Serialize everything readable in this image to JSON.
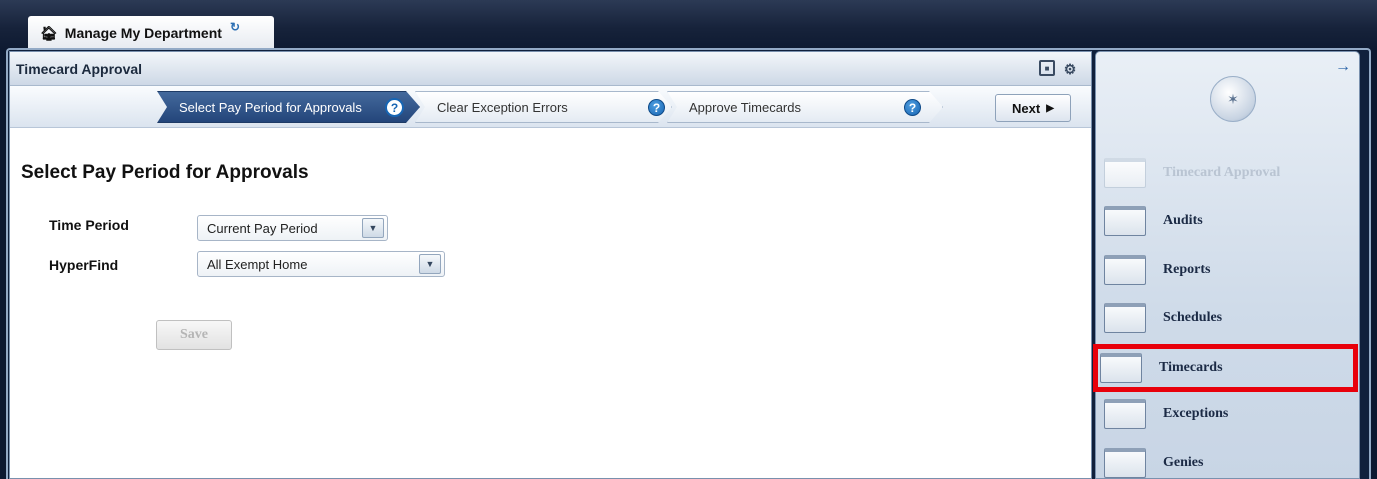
{
  "top_tab": {
    "label": "Manage My Department"
  },
  "panel": {
    "title": "Timecard Approval",
    "steps": [
      {
        "label": "Select Pay Period for Approvals",
        "state": "active"
      },
      {
        "label": "Clear Exception Errors",
        "state": "inactive"
      },
      {
        "label": "Approve Timecards",
        "state": "inactive"
      }
    ],
    "next_label": "Next",
    "page_title": "Select Pay Period for Approvals",
    "form": {
      "time_period_label": "Time Period",
      "time_period_value": "Current Pay Period",
      "hyperfind_label": "HyperFind",
      "hyperfind_value": "All Exempt Home",
      "save_label": "Save"
    }
  },
  "sidebar": {
    "items": [
      {
        "label": "Timecard Approval",
        "state": "disabled"
      },
      {
        "label": "Audits",
        "state": "normal"
      },
      {
        "label": "Reports",
        "state": "normal"
      },
      {
        "label": "Schedules",
        "state": "normal"
      },
      {
        "label": "Timecards",
        "state": "selected"
      },
      {
        "label": "Exceptions",
        "state": "normal"
      },
      {
        "label": "Genies",
        "state": "normal"
      }
    ]
  },
  "icons": {
    "home": "home-icon",
    "refresh": "refresh-icon",
    "maximize": "maximize-icon",
    "settings": "gear-icon",
    "help": "help-icon",
    "next_arrow": "play-arrow-icon",
    "dropdown": "chevron-down-icon",
    "collapse": "arrow-right-icon",
    "globe": "globe-icon"
  },
  "colors": {
    "highlight": "#e8000b",
    "active_step": "#2f5288",
    "help_blue": "#1765b3"
  }
}
